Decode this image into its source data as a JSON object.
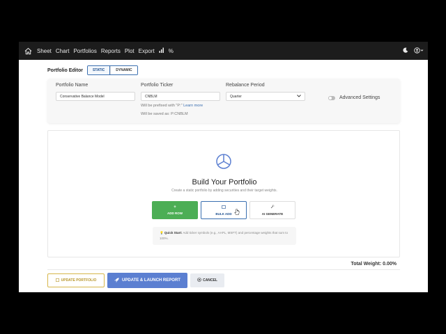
{
  "nav": {
    "items": [
      "Sheet",
      "Chart",
      "Portfolios",
      "Reports",
      "Plot",
      "Export"
    ],
    "icons": [
      "home-icon",
      "bar-chart-icon",
      "percent-icon",
      "moon-icon",
      "user-icon"
    ],
    "percent_glyph": "%"
  },
  "editor": {
    "title": "Portfolio Editor",
    "modes": {
      "static": "STATIC",
      "dynamic": "DYNAMIC"
    },
    "active_mode": "STATIC"
  },
  "settings": {
    "name_label": "Portfolio Name",
    "name_value": "Conservative Balance Model",
    "ticker_label": "Portfolio Ticker",
    "ticker_value": "CNBLM",
    "prefix_hint": "Will be prefixed with \"P:\"",
    "learn_more": "Learn more",
    "saved_as": "Will be saved as: P:CNBLM",
    "period_label": "Rebalance Period",
    "period_value": "Quarter",
    "advanced_label": "Advanced Settings"
  },
  "builder": {
    "title": "Build Your Portfolio",
    "subtitle": "Create a static portfolio by adding securities and their target weights.",
    "add_row": "ADD ROW",
    "bulk_add": "BULK ADD",
    "ai_generate": "AI GENERATE",
    "quick_label": "Quick Start:",
    "quick_text": "Add ticker symbols (e.g., AAPL, MSFT) and percentage weights that sum to 100%."
  },
  "total_weight": "Total Weight: 0.00%",
  "actions": {
    "update": "UPDATE PORTFOLIO",
    "launch": "UPDATE & LAUNCH REPORT",
    "cancel": "CANCEL"
  },
  "colors": {
    "accent": "#3a6fb0",
    "add_row": "#4cae55",
    "launch": "#5b7fd1",
    "update_border": "#d6b64a"
  }
}
